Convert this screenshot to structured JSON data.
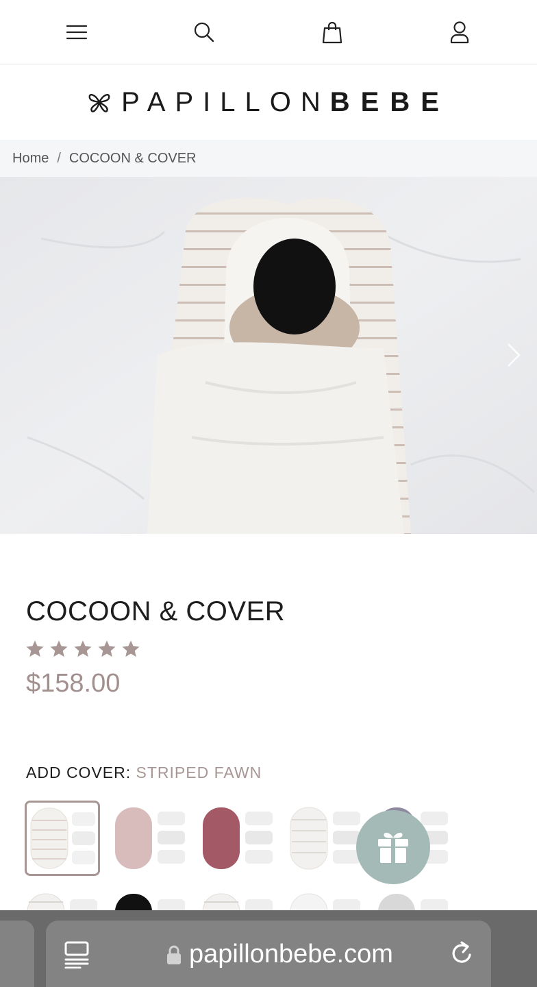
{
  "header": {
    "menu_icon": "hamburger-menu-icon",
    "search_icon": "search-icon",
    "cart_icon": "shopping-bag-icon",
    "account_icon": "user-account-icon"
  },
  "logo": {
    "text_light": "PAPILLON",
    "text_bold": "BEBE"
  },
  "breadcrumb": {
    "home": "Home",
    "separator": "/",
    "current": "COCOON & COVER"
  },
  "hero": {
    "next_arrow_icon": "chevron-right-icon"
  },
  "product": {
    "title": "COCOON & COVER",
    "rating": 5,
    "rating_max": 5,
    "price": "$158.00"
  },
  "cover": {
    "label": "ADD COVER:",
    "selected_value": "STRIPED FAWN"
  },
  "gift_button": {
    "icon": "gift-icon"
  },
  "browser": {
    "url": "papillonbebe.com",
    "tabs_icon": "tabs-overview-icon",
    "lock_icon": "lock-icon",
    "reload_icon": "reload-icon"
  },
  "colors": {
    "accent_price": "#a2908e",
    "selected_border": "#a89694",
    "gift_bg": "#a4bab7",
    "breadcrumb_bg": "#f4f6f8",
    "browser_bar": "#6a6a6a"
  }
}
